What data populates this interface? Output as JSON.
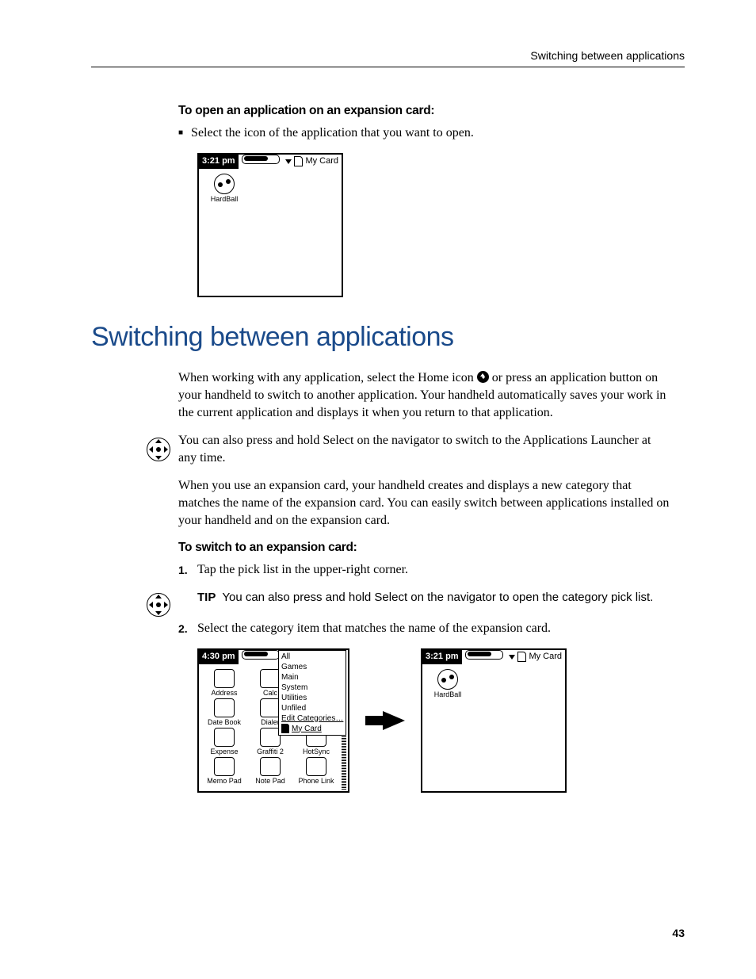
{
  "header": {
    "running": "Switching between applications"
  },
  "proc1": {
    "title": "To open an application on an expansion card:",
    "bullet": "Select the icon of the application that you want to open."
  },
  "device1": {
    "time": "3:21 pm",
    "category": "My Card",
    "apps": [
      {
        "name": "HardBall"
      }
    ]
  },
  "section": {
    "title": "Switching between applications",
    "p1_a": "When working with any application, select the Home icon ",
    "p1_b": " or press an application button on your handheld to switch to another application. Your handheld automatically saves your work in the current application and displays it when you return to that application.",
    "p2": "You can also press and hold Select on the navigator to switch to the Applications Launcher at any time.",
    "p3": "When you use an expansion card, your handheld creates and displays a new category that matches the name of the expansion card. You can easily switch between applications installed on your handheld and on the expansion card."
  },
  "proc2": {
    "title": "To switch to an expansion card:",
    "step1": "Tap the pick list in the upper-right corner.",
    "tip_label": "TIP",
    "tip_text": "You can also press and hold Select on the navigator to open the category pick list.",
    "step2": "Select the category item that matches the name of the expansion card."
  },
  "device2": {
    "time": "4:30 pm",
    "dropdown": [
      "All",
      "Games",
      "Main",
      "System",
      "Utilities",
      "Unfiled",
      "Edit Categories…"
    ],
    "dropdown_selected": "My Card",
    "apps": [
      "Address",
      "Calc",
      "",
      "Date Book",
      "Dialer",
      "",
      "Expense",
      "Graffiti 2",
      "HotSync",
      "Memo Pad",
      "Note Pad",
      "Phone Link"
    ]
  },
  "device3": {
    "time": "3:21 pm",
    "category": "My Card",
    "apps": [
      {
        "name": "HardBall"
      }
    ]
  },
  "page_number": "43"
}
